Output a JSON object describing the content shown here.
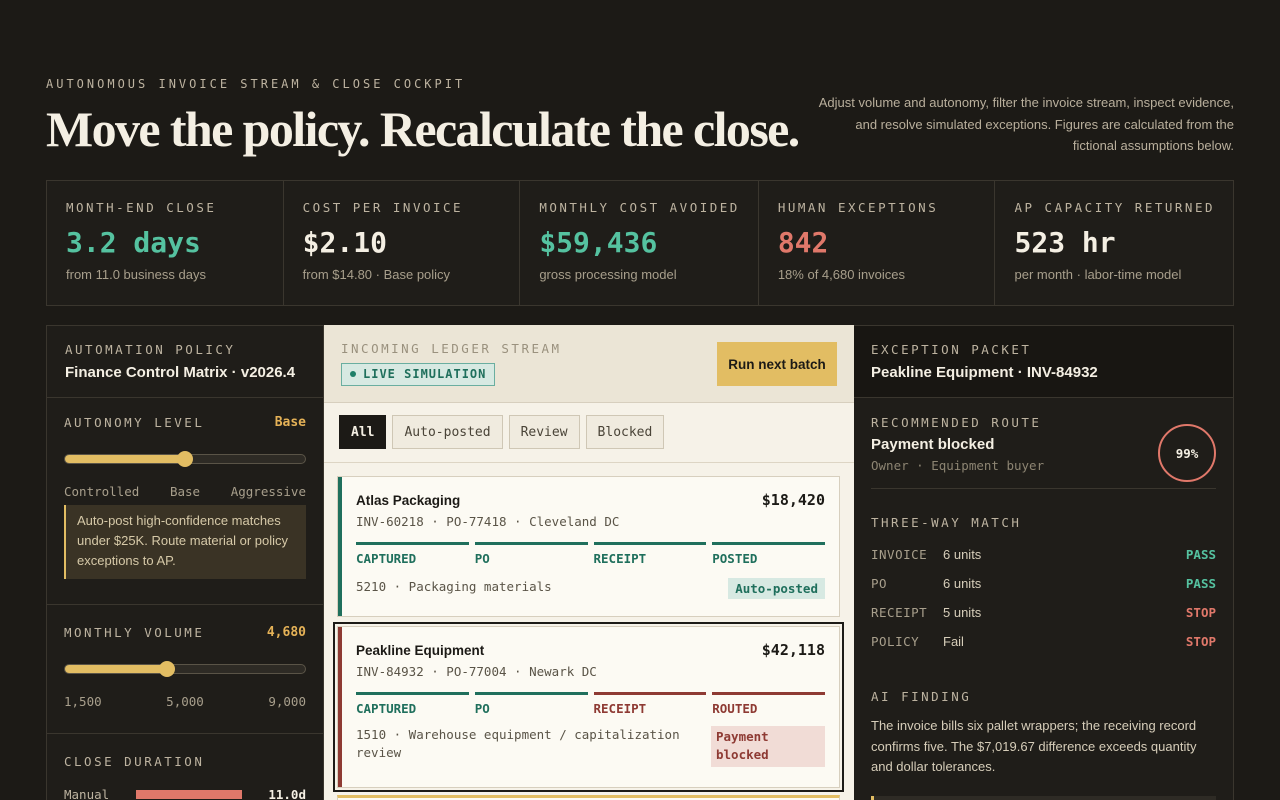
{
  "header": {
    "eyebrow": "AUTONOMOUS INVOICE STREAM & CLOSE COCKPIT",
    "title": "Move the policy. Recalculate the close.",
    "description": "Adjust volume and autonomy, filter the invoice stream, inspect evidence, and resolve simulated exceptions. Figures are calculated from the fictional assumptions below."
  },
  "kpis": [
    {
      "label": "MONTH-END CLOSE",
      "value": "3.2 days",
      "sub": "from 11.0 business days",
      "color": "#55c2a0"
    },
    {
      "label": "COST PER INVOICE",
      "value": "$2.10",
      "sub": "from $14.80 · Base policy",
      "color": "#f4efe3"
    },
    {
      "label": "MONTHLY COST AVOIDED",
      "value": "$59,436",
      "sub": "gross processing model",
      "color": "#55c2a0"
    },
    {
      "label": "HUMAN EXCEPTIONS",
      "value": "842",
      "sub": "18% of 4,680 invoices",
      "color": "#e0786a"
    },
    {
      "label": "AP CAPACITY RETURNED",
      "value": "523 hr",
      "sub": "per month · labor-time model",
      "color": "#f4efe3"
    }
  ],
  "policy": {
    "label": "AUTOMATION POLICY",
    "name": "Finance Control Matrix · v2026.4",
    "autonomy": {
      "label": "AUTONOMY LEVEL",
      "value": "Base",
      "level_fraction": 0.5,
      "ticks": [
        "Controlled",
        "Base",
        "Aggressive"
      ],
      "note": "Auto-post high-confidence matches under $25K. Route material or policy exceptions to AP."
    },
    "volume": {
      "label": "MONTHLY VOLUME",
      "value": "4,680",
      "level_fraction": 0.427,
      "ticks": [
        "1,500",
        "5,000",
        "9,000"
      ]
    },
    "duration": {
      "label": "CLOSE DURATION",
      "rows": [
        {
          "name": "Manual",
          "value": "11.0d",
          "fraction": 1.0
        }
      ]
    }
  },
  "stream": {
    "label": "INCOMING LEDGER STREAM",
    "badge": "LIVE SIMULATION",
    "run_button": "Run next batch",
    "filters": [
      "All",
      "Auto-posted",
      "Review",
      "Blocked"
    ],
    "invoices": [
      {
        "vendor": "Atlas Packaging",
        "amount": "$18,420",
        "refs": "INV-60218 · PO-77418 · Cleveland DC",
        "stages": [
          "CAPTURED",
          "PO",
          "RECEIPT",
          "POSTED"
        ],
        "account": "5210 · Packaging materials",
        "status": "Auto-posted",
        "stripe": "#1f6f5c"
      },
      {
        "vendor": "Peakline Equipment",
        "amount": "$42,118",
        "refs": "INV-84932 · PO-77004 · Newark DC",
        "stages": [
          "CAPTURED",
          "PO",
          "RECEIPT",
          "ROUTED"
        ],
        "account": "1510 · Warehouse equipment / capitalization review",
        "status": "Payment blocked",
        "stripe": "#8e3a33"
      }
    ]
  },
  "exception": {
    "label": "EXCEPTION PACKET",
    "title": "Peakline Equipment · INV-84932",
    "route_label": "RECOMMENDED ROUTE",
    "route": "Payment blocked",
    "owner": "Owner · Equipment buyer",
    "confidence": "99%",
    "match_label": "THREE-WAY MATCH",
    "match": [
      {
        "key": "INVOICE",
        "value": "6 units",
        "status": "PASS"
      },
      {
        "key": "PO",
        "value": "6 units",
        "status": "PASS"
      },
      {
        "key": "RECEIPT",
        "value": "5 units",
        "status": "STOP"
      },
      {
        "key": "POLICY",
        "value": "Fail",
        "status": "STOP"
      }
    ],
    "ai_label": "AI FINDING",
    "ai_text": "The invoice bills six pallet wrappers; the receiving record confirms five. The $7,019.67 difference exceeds quantity and dollar tolerances."
  }
}
